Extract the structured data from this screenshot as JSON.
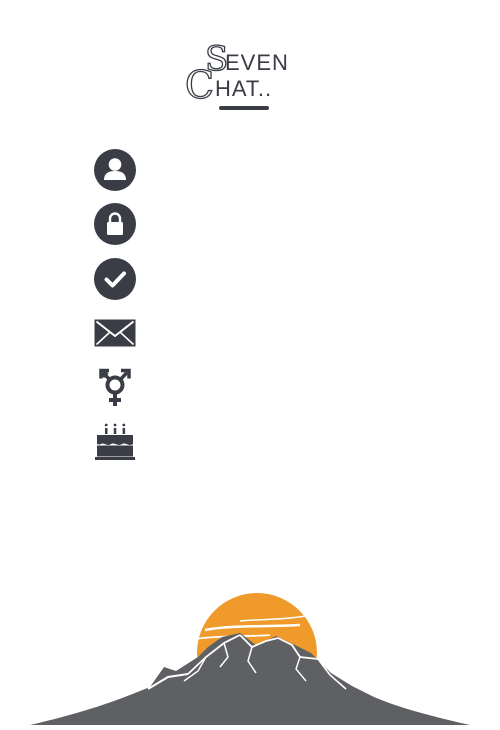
{
  "logo": {
    "initial_top": "S",
    "text_top": "EVEN",
    "initial_bottom": "C",
    "text_bottom": "HAT.."
  },
  "form": {
    "fields": [
      {
        "icon": "user-icon",
        "value": ""
      },
      {
        "icon": "lock-icon",
        "value": ""
      },
      {
        "icon": "check-circle-icon",
        "value": ""
      },
      {
        "icon": "envelope-icon",
        "value": ""
      },
      {
        "icon": "gender-icon",
        "value": ""
      },
      {
        "icon": "birthday-cake-icon",
        "value": ""
      }
    ]
  },
  "colors": {
    "icon": "#3a3d45",
    "sun": "#ef9a2b",
    "mountain": "#5f6064",
    "background": "#ffffff"
  }
}
